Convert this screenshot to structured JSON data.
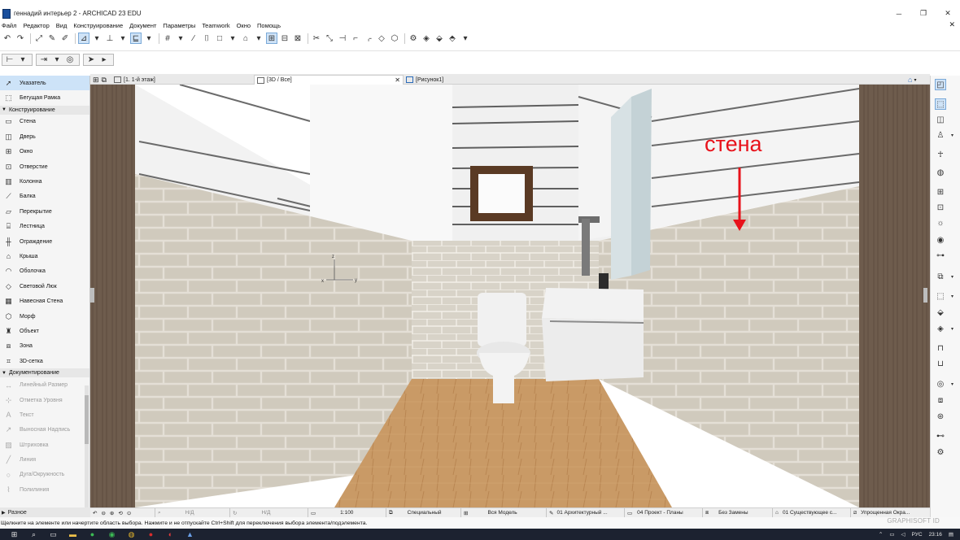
{
  "window": {
    "title": "геннадий интерьер 2 - ARCHICAD 23 EDU",
    "controls": [
      "minimize",
      "restore",
      "close"
    ]
  },
  "menu": [
    "Файл",
    "Редактор",
    "Вид",
    "Конструирование",
    "Документ",
    "Параметры",
    "Teamwork",
    "Окно",
    "Помощь"
  ],
  "tabs": [
    {
      "label": "[1. 1-й этаж]",
      "active": false
    },
    {
      "label": "[3D / Все]",
      "active": true
    },
    {
      "label": "[Рисунок1]",
      "active": false
    }
  ],
  "toolbox": {
    "pointer": "Указатель",
    "marquee": "Бегущая Рамка",
    "sections": [
      {
        "name": "Конструирование",
        "tools": [
          "Стена",
          "Дверь",
          "Окно",
          "Отверстие",
          "Колонна",
          "Балка",
          "Перекрытие",
          "Лестница",
          "Ограждение",
          "Крыша",
          "Оболочка",
          "Световой Люк",
          "Навесная Стена",
          "Морф",
          "Объект",
          "Зона",
          "3D-сетка"
        ]
      },
      {
        "name": "Документирование",
        "tools": [
          "Линейный Размер",
          "Отметка Уровня",
          "Текст",
          "Выносная Надпись",
          "Штриховка",
          "Линия",
          "Дуга/Окружность",
          "Полилиния"
        ]
      }
    ],
    "misc": "Разное"
  },
  "viewport": {
    "annotation": "стена",
    "annotation_color": "#e8121b",
    "axis_labels": {
      "x": "x",
      "y": "y",
      "z": "z"
    }
  },
  "viewbar": {
    "nd1": "Н/Д",
    "nd2": "Н/Д",
    "scale": "1:100",
    "layer": "Специальный",
    "model": "Вся Модель",
    "pen": "01 Архитектурный ...",
    "mvo": "04 Проект - Планы",
    "override": "Без Замены",
    "renovation": "01 Существующее с...",
    "structure": "Упрощенная Окра..."
  },
  "status": {
    "message": "Щелкните на элементе или начертите область выбора. Нажмите и не отпускайте Ctrl+Shift для переключения выбора элемента/подэлемента.",
    "brand": "GRAPHISOFT ID"
  },
  "taskbar": {
    "language": "РУС",
    "time": "23:16"
  }
}
